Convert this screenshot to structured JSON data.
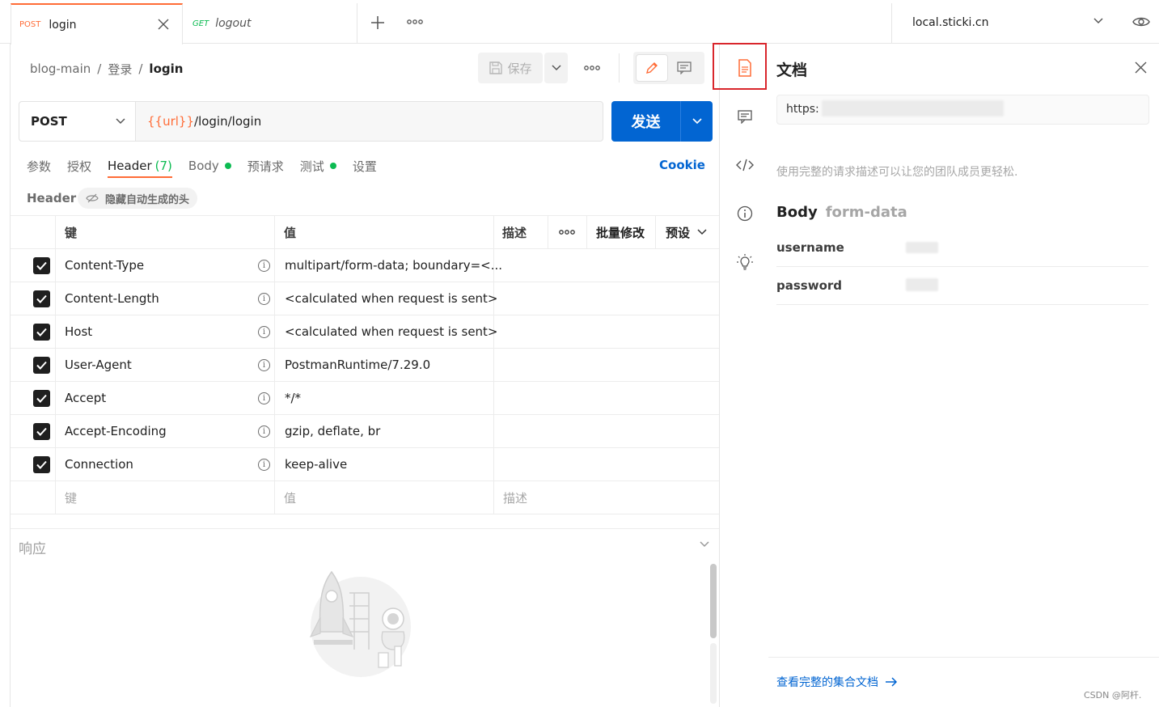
{
  "tabs": [
    {
      "method": "POST",
      "name": "login"
    },
    {
      "method": "GET",
      "name": "logout"
    }
  ],
  "environment": {
    "name": "local.sticki.cn"
  },
  "breadcrumb": {
    "collection": "blog-main",
    "folder": "登录",
    "request": "login"
  },
  "toolbar": {
    "save_label": "保存"
  },
  "request": {
    "method": "POST",
    "url_var": "{{url}}",
    "url_path": "/login/login",
    "send_label": "发送"
  },
  "subtabs": {
    "params": "参数",
    "auth": "授权",
    "headers": "Header",
    "headers_count": "(7)",
    "body": "Body",
    "pre_request": "预请求",
    "tests": "测试",
    "settings": "设置",
    "cookie": "Cookie"
  },
  "header_bar": {
    "title": "Header",
    "toggle_label": "隐藏自动生成的头"
  },
  "table": {
    "col_key": "键",
    "col_value": "值",
    "col_desc": "描述",
    "bulk_edit": "批量修改",
    "presets": "预设",
    "rows": [
      {
        "key": "Content-Type",
        "value": "multipart/form-data; boundary=<..."
      },
      {
        "key": "Content-Length",
        "value": "<calculated when request is sent>"
      },
      {
        "key": "Host",
        "value": "<calculated when request is sent>"
      },
      {
        "key": "User-Agent",
        "value": "PostmanRuntime/7.29.0"
      },
      {
        "key": "Accept",
        "value": "*/*"
      },
      {
        "key": "Accept-Encoding",
        "value": "gzip, deflate, br"
      },
      {
        "key": "Connection",
        "value": "keep-alive"
      }
    ],
    "placeholder_key": "键",
    "placeholder_value": "值",
    "placeholder_desc": "描述"
  },
  "response": {
    "title": "响应"
  },
  "docs": {
    "title": "文档",
    "url_visible": "https:",
    "description_hint": "使用完整的请求描述可以让您的团队成员更轻松.",
    "body_label": "Body",
    "body_type": "form-data",
    "fields": [
      "username",
      "password"
    ],
    "footer_link": "查看完整的集合文档"
  },
  "watermark": "CSDN @阿杆.",
  "colors": {
    "accent": "#ff6c37",
    "primary": "#0265d2",
    "success": "#0cbb52",
    "highlight_box": "#d9262c"
  }
}
